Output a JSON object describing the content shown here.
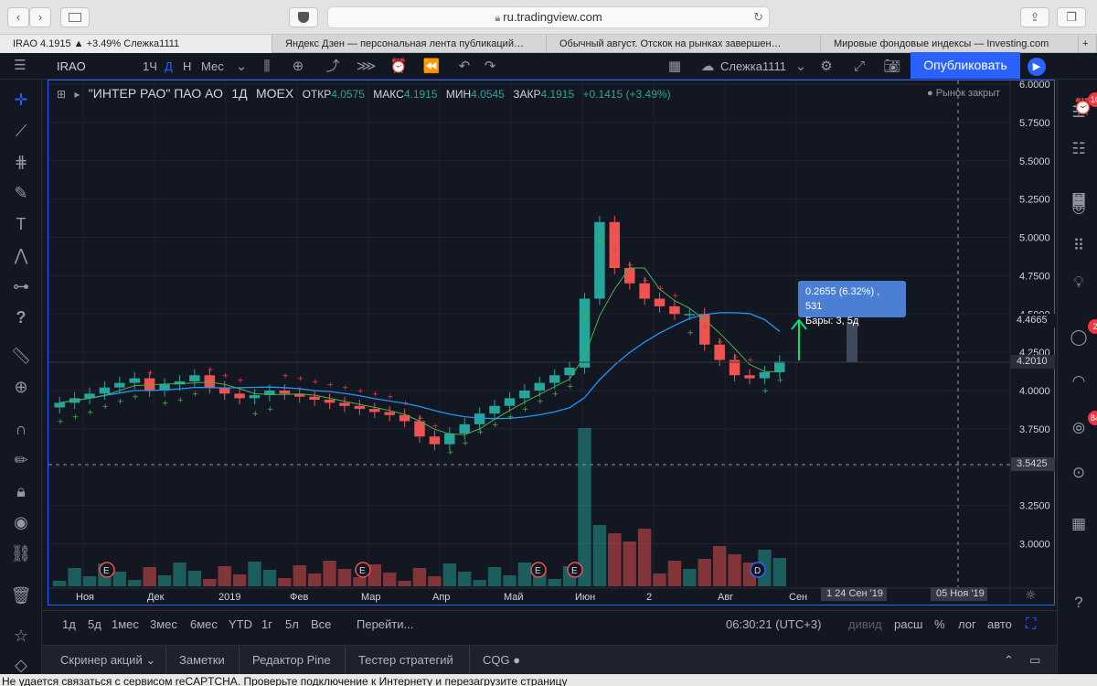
{
  "browser": {
    "url": "ru.tradingview.com",
    "back": "‹",
    "forward": "›",
    "tabs": [
      "IRAO 4.1915 ▲ +3.49% Слежка1111",
      "Яндекс Дзен — персональная лента публикаций…",
      "Обычный август. Отскок на рынках завершен…",
      "Мировые фондовые индексы — Investing.com"
    ]
  },
  "toolbar": {
    "symbol": "IRAO",
    "intervals": [
      "1Ч",
      "Д",
      "Н",
      "Мес"
    ],
    "active_interval": "Д",
    "layout_name": "Слежка1111",
    "publish_label": "Опубликовать"
  },
  "legend": {
    "name": "\"ИНТЕР РАО\" ПАО АО",
    "interval": "1Д",
    "exchange": "MOEX",
    "open_label": "ОТКР",
    "open": "4.0575",
    "high_label": "МАКС",
    "high": "4.1915",
    "low_label": "МИН",
    "low": "4.0545",
    "close_label": "ЗАКР",
    "close": "4.1915",
    "change": "+0.1415 (+3.49%)",
    "market_status": "Рынок закрыт"
  },
  "measure": {
    "line1": "0.2655 (6.32%) , 531",
    "line2": "Бары: 3, 5д"
  },
  "price_tags": {
    "ma": "4.4665",
    "last": "4.2010",
    "crosshair": "3.5425"
  },
  "time_tags": {
    "left": "1  24 Сен '19",
    "right": "05 Ноя '19"
  },
  "ranges": [
    "1д",
    "5д",
    "1мес",
    "3мес",
    "6мес",
    "YTD",
    "1г",
    "5л",
    "Все"
  ],
  "goto_label": "Перейти...",
  "clock": "06:30:21 (UTC+3)",
  "scale_options": [
    "дивид",
    "расш",
    "%",
    "лог",
    "авто"
  ],
  "bottom_tabs": [
    "Скринер акций",
    "Заметки",
    "Редактор Pine",
    "Тестер стратегий",
    "CQG"
  ],
  "status_message": "Не удается связаться с сервисом reCAPTCHA. Проверьте подключение к Интернету и перезагрузите страницу",
  "badges": {
    "alerts": "10",
    "ideas": "2",
    "chats": "84"
  },
  "colors": {
    "up": "#26a69a",
    "down": "#ef5350",
    "accent": "#2962ff",
    "ma_fast": "#4caf50",
    "ma_slow": "#2196f3",
    "sar": "#e53950"
  },
  "chart_data": {
    "type": "line",
    "x_labels": [
      "Ноя",
      "Дек",
      "2019",
      "Фев",
      "Мар",
      "Апр",
      "Май",
      "Июн",
      "2",
      "Авг",
      "Сен"
    ],
    "y_ticks": [
      "6.0000",
      "5.7500",
      "5.5000",
      "5.2500",
      "5.0000",
      "4.7500",
      "4.5000",
      "4.2500",
      "4.0000",
      "3.7500",
      "3.5000",
      "3.2500",
      "3.0000"
    ],
    "ylim": [
      2.8,
      6.0
    ],
    "close_series": [
      3.92,
      3.95,
      3.98,
      4.02,
      4.05,
      4.08,
      4.0,
      4.04,
      4.06,
      4.1,
      4.02,
      3.98,
      3.95,
      3.97,
      4.0,
      3.98,
      3.96,
      3.94,
      3.92,
      3.9,
      3.88,
      3.86,
      3.84,
      3.8,
      3.7,
      3.65,
      3.72,
      3.78,
      3.85,
      3.9,
      3.95,
      4.0,
      4.05,
      4.1,
      4.15,
      4.6,
      5.1,
      4.8,
      4.7,
      4.6,
      4.55,
      4.5,
      4.5,
      4.3,
      4.2,
      4.1,
      4.08,
      4.12,
      4.19
    ],
    "events": [
      "E",
      "E",
      "E",
      "E",
      "D",
      "E"
    ]
  }
}
